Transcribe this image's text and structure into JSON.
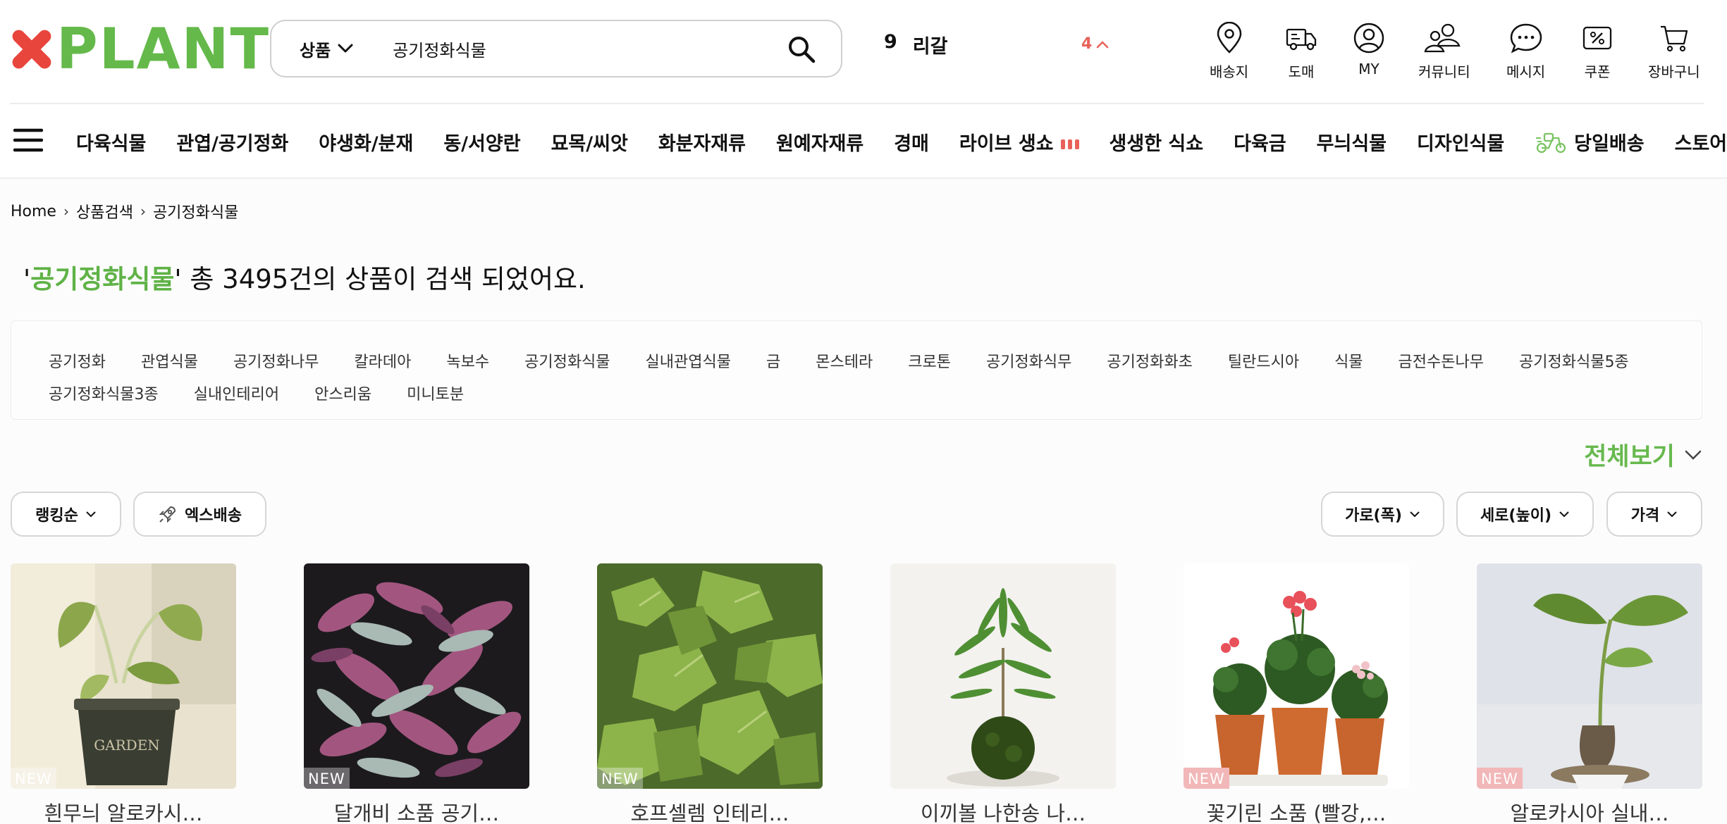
{
  "header": {
    "logo_text": "PLANT",
    "search": {
      "category": "상품",
      "query": "공기정화식물"
    },
    "ticker": {
      "rank": "9",
      "keyword": "리갈"
    },
    "ticker_toggle": "4",
    "icons": [
      {
        "label": "배송지",
        "icon": "location-pin-icon"
      },
      {
        "label": "도매",
        "icon": "truck-icon"
      },
      {
        "label": "MY",
        "icon": "user-icon"
      },
      {
        "label": "커뮤니티",
        "icon": "community-icon"
      },
      {
        "label": "메시지",
        "icon": "chat-icon"
      },
      {
        "label": "쿠폰",
        "icon": "coupon-icon"
      },
      {
        "label": "장바구니",
        "icon": "cart-icon"
      }
    ]
  },
  "nav": {
    "categories": [
      "다육식물",
      "관엽/공기정화",
      "야생화/분재",
      "동/서양란",
      "묘목/씨앗",
      "화분자재류",
      "원예자재류",
      "경매",
      "라이브 생쇼",
      "생생한 식쇼",
      "다육금",
      "무늬식물",
      "디자인식물",
      "당일배송",
      "스토어"
    ]
  },
  "breadcrumb": [
    "Home",
    "상품검색",
    "공기정화식물"
  ],
  "result": {
    "prefix": "'",
    "keyword": "공기정화식물",
    "suffix": "' 총 3495건의 상품이 검색 되었어요."
  },
  "related_tags": {
    "row1": [
      "공기정화",
      "관엽식물",
      "공기정화나무",
      "칼라데아",
      "녹보수",
      "공기정화식물",
      "실내관엽식물",
      "금",
      "몬스테라",
      "크로톤",
      "공기정화식무",
      "공기정화화초",
      "틸란드시아",
      "식물",
      "금전수돈나무",
      "공기정화식물5종"
    ],
    "row2": [
      "공기정화식물3종",
      "실내인테리어",
      "안스리움",
      "미니토분"
    ]
  },
  "view_all": "전체보기",
  "filters": {
    "sort": "랭킹순",
    "express": "엑스배송",
    "width": "가로(폭)",
    "height": "세로(높이)",
    "price": "가격"
  },
  "products": [
    {
      "name": "흰무늬 알로카시…",
      "badge": "NEW"
    },
    {
      "name": "달개비 소품 공기…",
      "badge": "NEW"
    },
    {
      "name": "호프셀렘 인테리…",
      "badge": "NEW"
    },
    {
      "name": "이끼볼 나한송 나…",
      "badge": ""
    },
    {
      "name": "꽃기린 소품 (빨강,…",
      "badge": "NEW"
    },
    {
      "name": "알로카시아 실내…",
      "badge": "NEW"
    }
  ],
  "colors": {
    "brand_green": "#5fb246",
    "brand_red": "#e8453c",
    "accent_red": "#e8625a"
  }
}
